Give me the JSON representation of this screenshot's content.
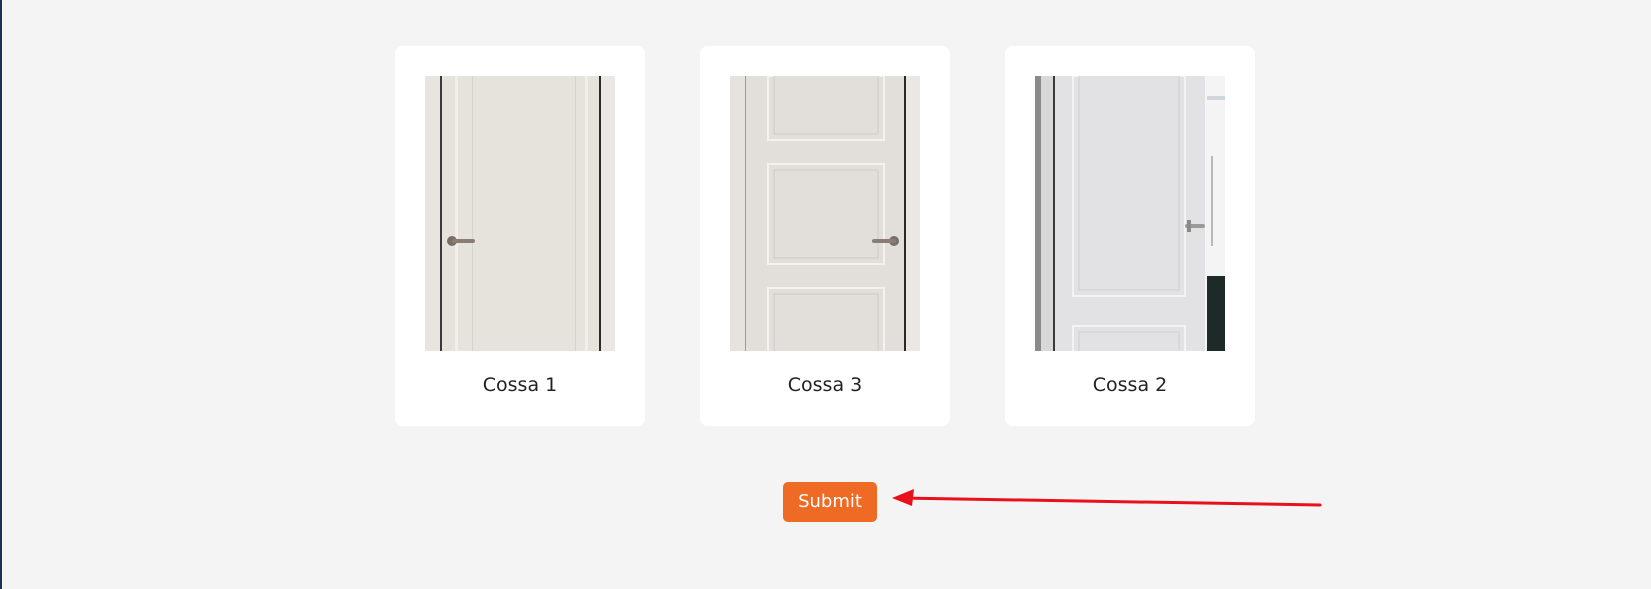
{
  "cards": [
    {
      "label": "Cossa 1",
      "image": "plain-door-image"
    },
    {
      "label": "Cossa 3",
      "image": "three-panel-door-image"
    },
    {
      "label": "Cossa 2",
      "image": "two-panel-door-image"
    }
  ],
  "submit": {
    "label": "Submit"
  },
  "colors": {
    "background": "#f4f4f4",
    "card": "#ffffff",
    "accent": "#ee6a25",
    "annotation_arrow": "#e8101a"
  }
}
